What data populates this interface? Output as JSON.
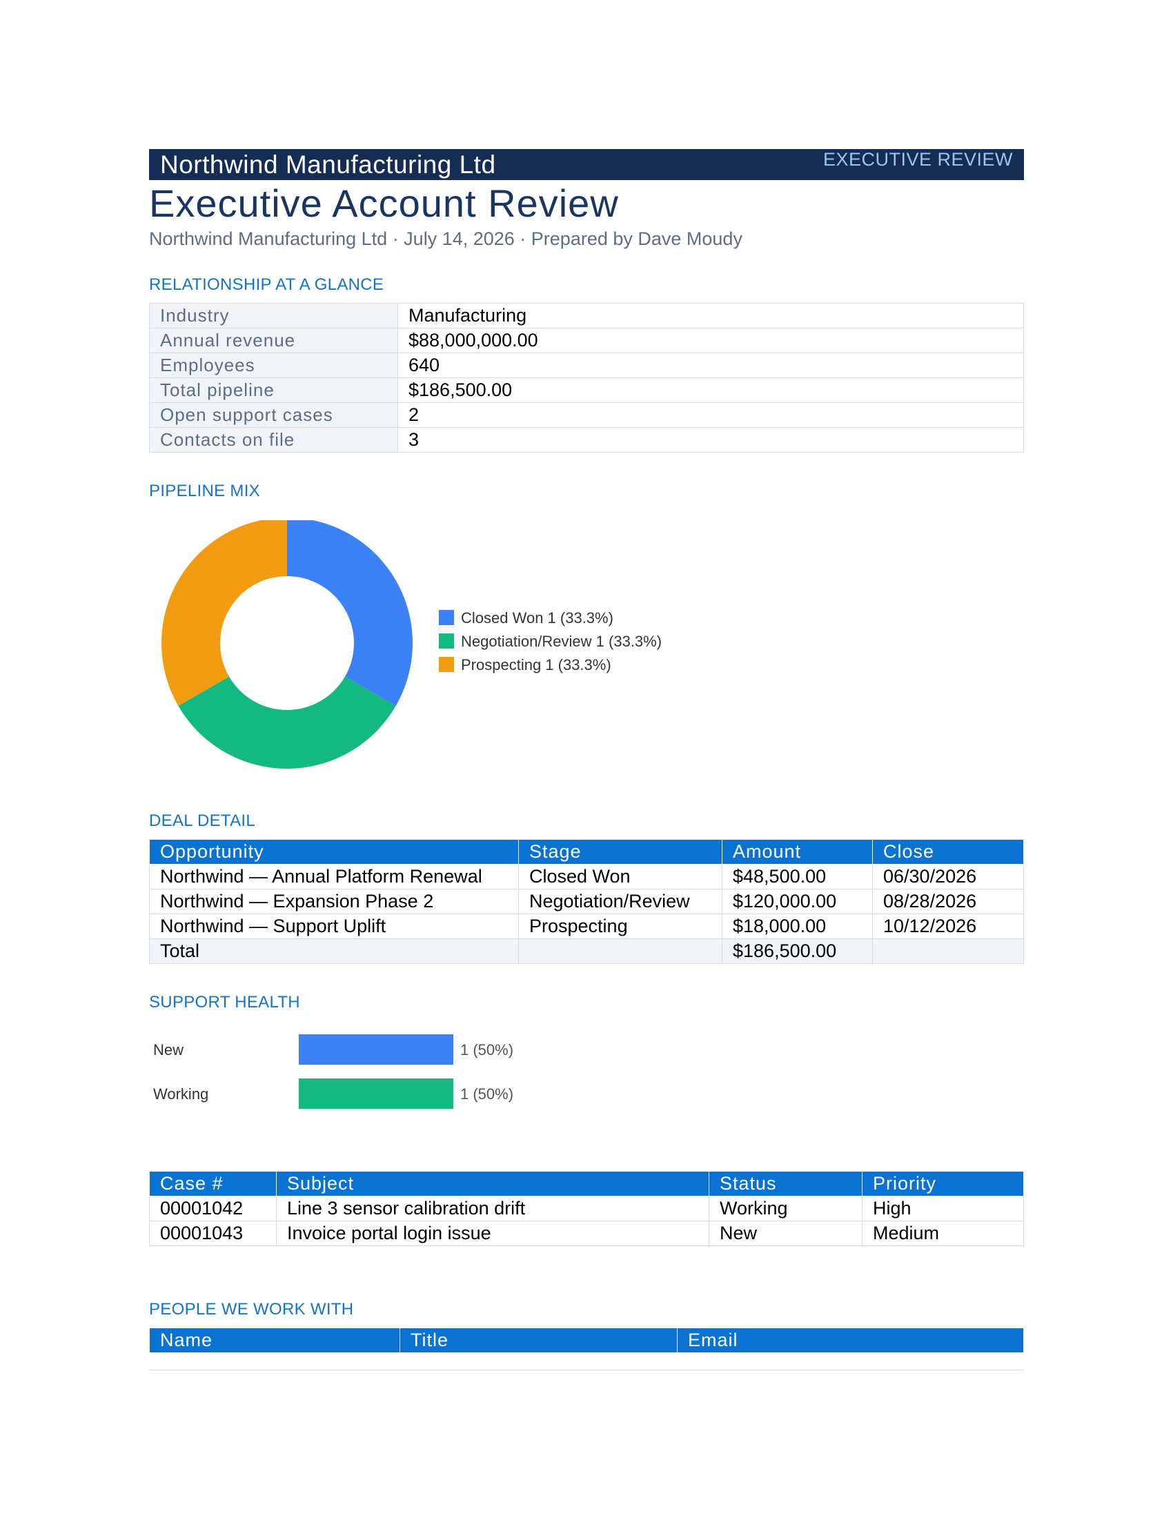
{
  "header": {
    "company": "Northwind Manufacturing Ltd",
    "tag": "EXECUTIVE REVIEW",
    "title": "Executive Account Review",
    "subtitle": "Northwind Manufacturing Ltd · July 14, 2026 · Prepared by Dave Moudy"
  },
  "glance": {
    "heading": "RELATIONSHIP AT A GLANCE",
    "rows": [
      {
        "label": "Industry",
        "value": "Manufacturing"
      },
      {
        "label": "Annual revenue",
        "value": "$88,000,000.00"
      },
      {
        "label": "Employees",
        "value": "640"
      },
      {
        "label": "Total pipeline",
        "value": "$186,500.00"
      },
      {
        "label": "Open support cases",
        "value": "2"
      },
      {
        "label": "Contacts on file",
        "value": "3"
      }
    ]
  },
  "pipeline": {
    "heading": "PIPELINE MIX",
    "legend": [
      "Closed Won 1 (33.3%)",
      "Negotiation/Review 1 (33.3%)",
      "Prospecting 1 (33.3%)"
    ]
  },
  "deals": {
    "heading": "DEAL DETAIL",
    "columns": [
      "Opportunity",
      "Stage",
      "Amount",
      "Close"
    ],
    "rows": [
      [
        "Northwind — Annual Platform Renewal",
        "Closed Won",
        "$48,500.00",
        "06/30/2026"
      ],
      [
        "Northwind — Expansion Phase 2",
        "Negotiation/Review",
        "$120,000.00",
        "08/28/2026"
      ],
      [
        "Northwind — Support Uplift",
        "Prospecting",
        "$18,000.00",
        "10/12/2026"
      ]
    ],
    "total_label": "Total",
    "total_amount": "$186,500.00"
  },
  "support": {
    "heading": "SUPPORT HEALTH",
    "columns": [
      "Case #",
      "Subject",
      "Status",
      "Priority"
    ],
    "rows": [
      [
        "00001042",
        "Line 3 sensor calibration drift",
        "Working",
        "High"
      ],
      [
        "00001043",
        "Invoice portal login issue",
        "New",
        "Medium"
      ]
    ]
  },
  "people": {
    "heading": "PEOPLE WE WORK WITH",
    "columns": [
      "Name",
      "Title",
      "Email"
    ]
  },
  "chart_data": [
    {
      "type": "pie",
      "donut": true,
      "categories": [
        "Closed Won",
        "Negotiation/Review",
        "Prospecting"
      ],
      "values": [
        1,
        1,
        1
      ],
      "percent_labels": [
        "33.3%",
        "33.3%",
        "33.3%"
      ],
      "colors": [
        "#3b82f6",
        "#12b981",
        "#f39c12"
      ],
      "legend_position": "right"
    },
    {
      "type": "bar",
      "orientation": "horizontal",
      "categories": [
        "New",
        "Working"
      ],
      "values": [
        1,
        1
      ],
      "value_labels": [
        "1 (50%)",
        "1 (50%)"
      ],
      "colors": [
        "#3b82f6",
        "#12b981"
      ]
    }
  ]
}
